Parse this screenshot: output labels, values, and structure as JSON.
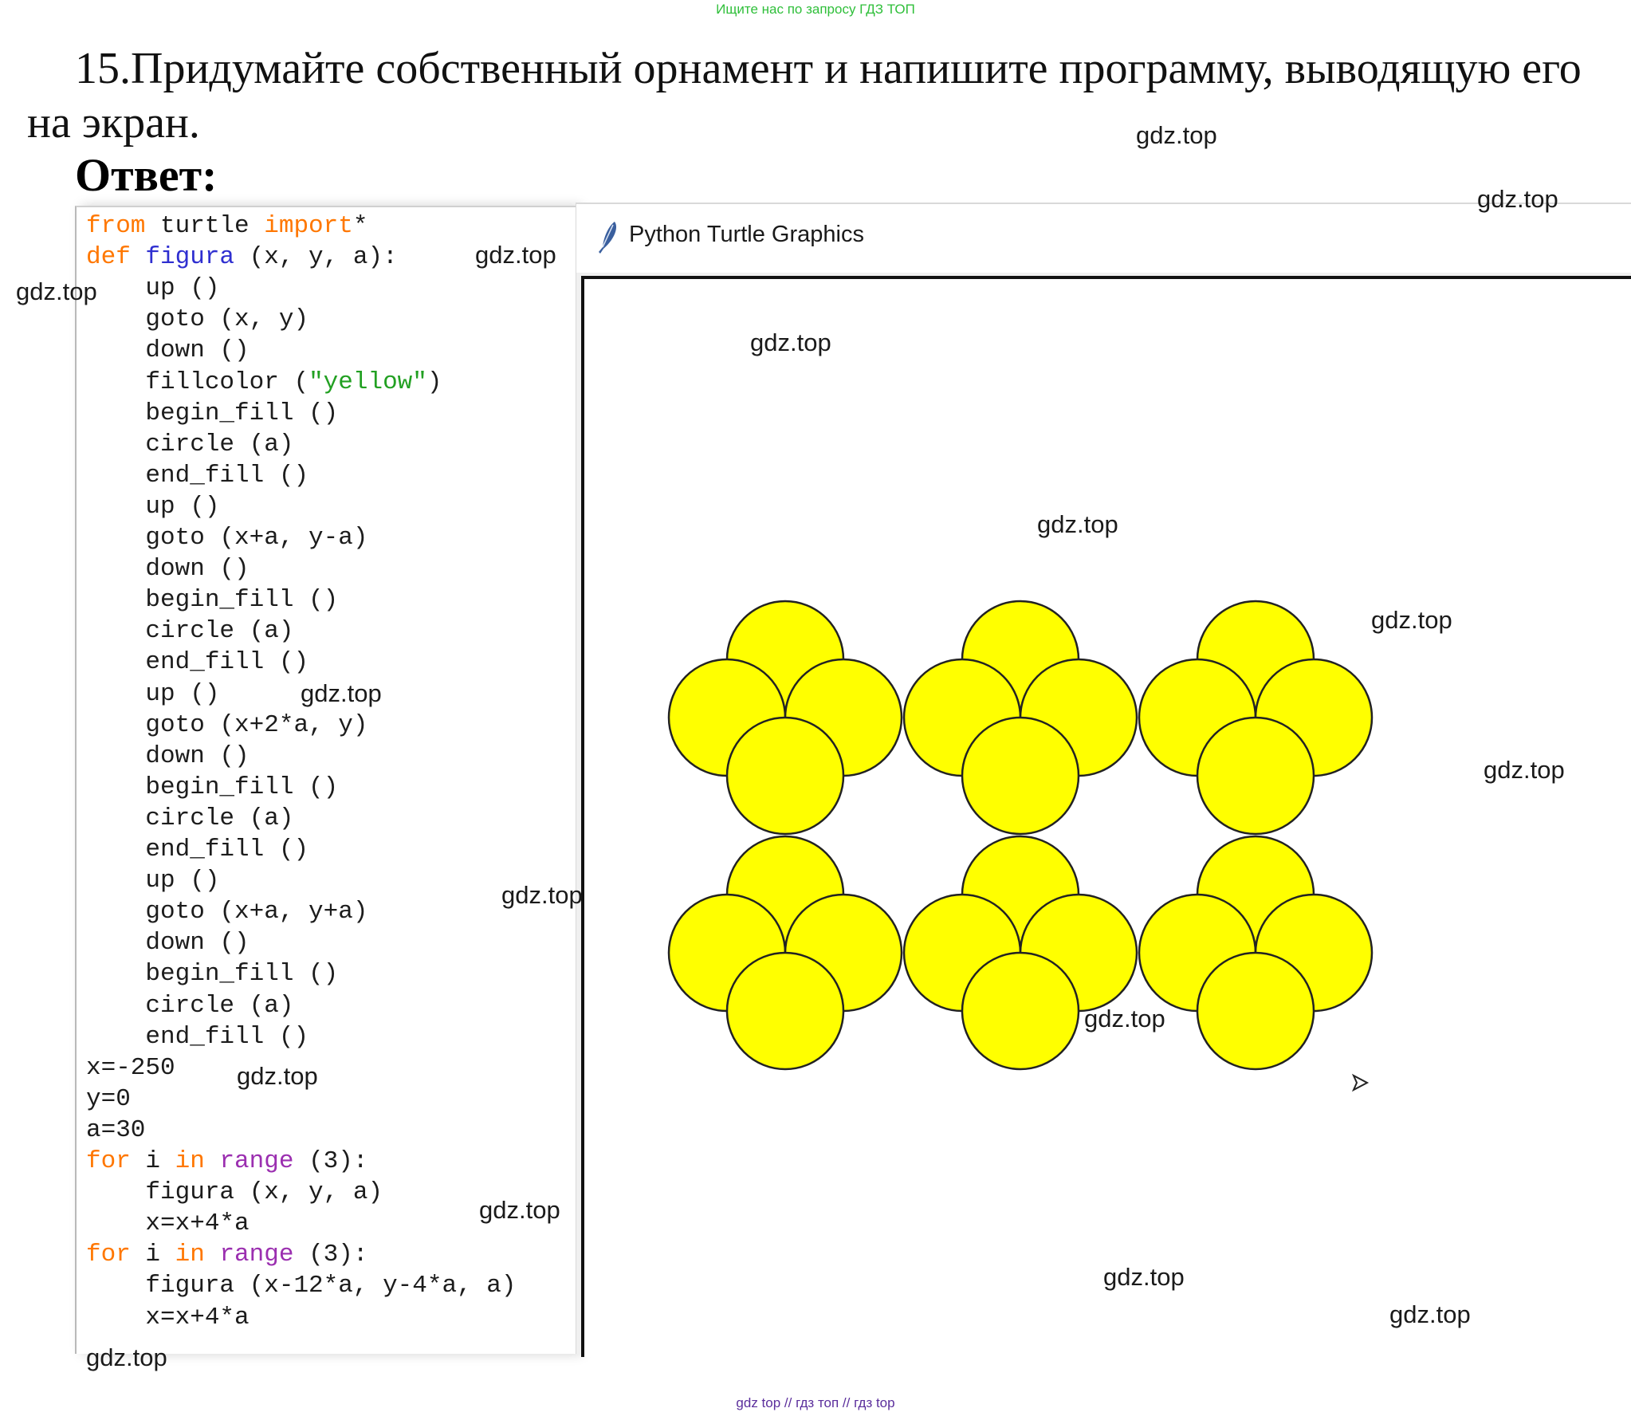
{
  "top_note": "Ищите нас по запросу ГДЗ ТОП",
  "task": {
    "number": "15.",
    "text": "Придумайте собственный орнамент и напишите программу, выводящую его на экран."
  },
  "answer_label": "Ответ:",
  "code": {
    "lines": [
      {
        "indent": "",
        "parts": [
          {
            "t": "from",
            "c": "kw"
          },
          {
            "t": " turtle ",
            "c": ""
          },
          {
            "t": "import",
            "c": "kw"
          },
          {
            "t": "*",
            "c": ""
          }
        ]
      },
      {
        "indent": "",
        "parts": [
          {
            "t": "def",
            "c": "kw"
          },
          {
            "t": " ",
            "c": ""
          },
          {
            "t": "figura",
            "c": "fn"
          },
          {
            "t": " (x, y, a):",
            "c": ""
          }
        ]
      },
      {
        "indent": "    ",
        "parts": [
          {
            "t": "up ()",
            "c": ""
          }
        ]
      },
      {
        "indent": "    ",
        "parts": [
          {
            "t": "goto (x, y)",
            "c": ""
          }
        ]
      },
      {
        "indent": "    ",
        "parts": [
          {
            "t": "down ()",
            "c": ""
          }
        ]
      },
      {
        "indent": "    ",
        "parts": [
          {
            "t": "fillcolor (",
            "c": ""
          },
          {
            "t": "\"yellow\"",
            "c": "str"
          },
          {
            "t": ")",
            "c": ""
          }
        ]
      },
      {
        "indent": "    ",
        "parts": [
          {
            "t": "begin_fill ()",
            "c": ""
          }
        ]
      },
      {
        "indent": "    ",
        "parts": [
          {
            "t": "circle (a)",
            "c": ""
          }
        ]
      },
      {
        "indent": "    ",
        "parts": [
          {
            "t": "end_fill ()",
            "c": ""
          }
        ]
      },
      {
        "indent": "    ",
        "parts": [
          {
            "t": "up ()",
            "c": ""
          }
        ]
      },
      {
        "indent": "    ",
        "parts": [
          {
            "t": "goto (x+a, y-a)",
            "c": ""
          }
        ]
      },
      {
        "indent": "    ",
        "parts": [
          {
            "t": "down ()",
            "c": ""
          }
        ]
      },
      {
        "indent": "    ",
        "parts": [
          {
            "t": "begin_fill ()",
            "c": ""
          }
        ]
      },
      {
        "indent": "    ",
        "parts": [
          {
            "t": "circle (a)",
            "c": ""
          }
        ]
      },
      {
        "indent": "    ",
        "parts": [
          {
            "t": "end_fill ()",
            "c": ""
          }
        ]
      },
      {
        "indent": "    ",
        "parts": [
          {
            "t": "up ()",
            "c": ""
          }
        ]
      },
      {
        "indent": "    ",
        "parts": [
          {
            "t": "goto (x+2*a, y)",
            "c": ""
          }
        ]
      },
      {
        "indent": "    ",
        "parts": [
          {
            "t": "down ()",
            "c": ""
          }
        ]
      },
      {
        "indent": "    ",
        "parts": [
          {
            "t": "begin_fill ()",
            "c": ""
          }
        ]
      },
      {
        "indent": "    ",
        "parts": [
          {
            "t": "circle (a)",
            "c": ""
          }
        ]
      },
      {
        "indent": "    ",
        "parts": [
          {
            "t": "end_fill ()",
            "c": ""
          }
        ]
      },
      {
        "indent": "    ",
        "parts": [
          {
            "t": "up ()",
            "c": ""
          }
        ]
      },
      {
        "indent": "    ",
        "parts": [
          {
            "t": "goto (x+a, y+a)",
            "c": ""
          }
        ]
      },
      {
        "indent": "    ",
        "parts": [
          {
            "t": "down ()",
            "c": ""
          }
        ]
      },
      {
        "indent": "    ",
        "parts": [
          {
            "t": "begin_fill ()",
            "c": ""
          }
        ]
      },
      {
        "indent": "    ",
        "parts": [
          {
            "t": "circle (a)",
            "c": ""
          }
        ]
      },
      {
        "indent": "    ",
        "parts": [
          {
            "t": "end_fill ()",
            "c": ""
          }
        ]
      },
      {
        "indent": "",
        "parts": [
          {
            "t": "x=-250",
            "c": ""
          }
        ]
      },
      {
        "indent": "",
        "parts": [
          {
            "t": "y=0",
            "c": ""
          }
        ]
      },
      {
        "indent": "",
        "parts": [
          {
            "t": "a=30",
            "c": ""
          }
        ]
      },
      {
        "indent": "",
        "parts": [
          {
            "t": "for",
            "c": "kw"
          },
          {
            "t": " i ",
            "c": ""
          },
          {
            "t": "in",
            "c": "kw"
          },
          {
            "t": " ",
            "c": ""
          },
          {
            "t": "range",
            "c": "bi"
          },
          {
            "t": " (3):",
            "c": ""
          }
        ]
      },
      {
        "indent": "    ",
        "parts": [
          {
            "t": "figura (x, y, a)",
            "c": ""
          }
        ]
      },
      {
        "indent": "    ",
        "parts": [
          {
            "t": "x=x+4*a",
            "c": ""
          }
        ]
      },
      {
        "indent": "",
        "parts": [
          {
            "t": "for",
            "c": "kw"
          },
          {
            "t": " i ",
            "c": ""
          },
          {
            "t": "in",
            "c": "kw"
          },
          {
            "t": " ",
            "c": ""
          },
          {
            "t": "range",
            "c": "bi"
          },
          {
            "t": " (3):",
            "c": ""
          }
        ]
      },
      {
        "indent": "    ",
        "parts": [
          {
            "t": "figura (x-12*a, y-4*a, a)",
            "c": ""
          }
        ]
      },
      {
        "indent": "    ",
        "parts": [
          {
            "t": "x=x+4*a",
            "c": ""
          }
        ]
      }
    ]
  },
  "turtle_window": {
    "title": "Python Turtle Graphics",
    "fill_color": "#ffff00",
    "stroke_color": "#222222",
    "ornament": {
      "rows": 2,
      "cols": 3,
      "circles_per_figure": 4
    }
  },
  "watermarks": [
    "gdz.top",
    "gdz.top",
    "gdz.top",
    "gdz.top",
    "gdz.top",
    "gdz.top",
    "gdz.top",
    "gdz.top",
    "gdz.top",
    "gdz.top",
    "gdz.top",
    "gdz.top",
    "gdz.top",
    "gdz.top",
    "gdz.top",
    "gdz.top"
  ],
  "footer": "gdz top  //  гдз топ  //  гдз top"
}
